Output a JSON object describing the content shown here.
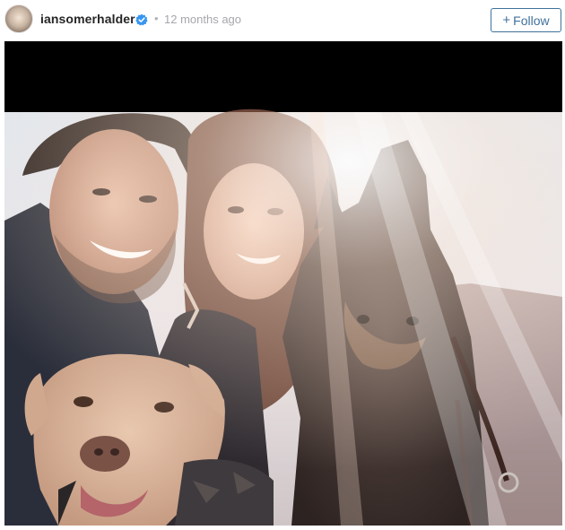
{
  "post_header": {
    "username": "iansomerhalder",
    "verified_icon": "verified-badge-icon",
    "separator": "•",
    "timestamp": "12 months ago",
    "follow_label": "Follow",
    "follow_icon": "plus-icon",
    "accent_color": "#3f729b",
    "verified_color": "#3897f0"
  },
  "post_media": {
    "kind": "photo",
    "icon": "photo-image"
  }
}
